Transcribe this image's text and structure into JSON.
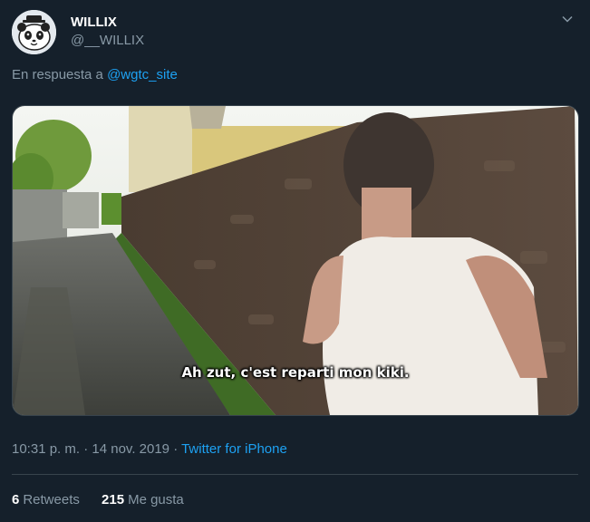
{
  "author": {
    "name": "WILLIX",
    "handle": "@__WILLIX",
    "avatar_icon": "panda-avatar-icon"
  },
  "menu_icon": "chevron-down-icon",
  "reply": {
    "prefix": "En respuesta a ",
    "mention": "@wgtc_site"
  },
  "media": {
    "subtitle": "Ah zut, c'est reparti mon kiki."
  },
  "meta": {
    "time": "10:31 p. m.",
    "sep1": " · ",
    "date": "14 nov. 2019",
    "sep2": " · ",
    "source": "Twitter for iPhone"
  },
  "stats": {
    "retweets_count": "6",
    "retweets_label": "Retweets",
    "likes_count": "215",
    "likes_label": "Me gusta"
  },
  "colors": {
    "background": "#15202b",
    "link": "#1da1f2",
    "secondary_text": "#8899a6",
    "border": "#38444d"
  }
}
